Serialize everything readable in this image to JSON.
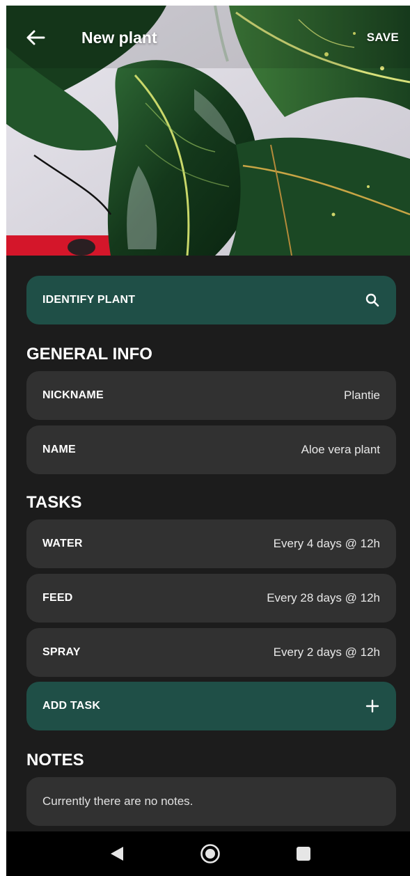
{
  "header": {
    "title": "New plant",
    "save_label": "SAVE"
  },
  "identify": {
    "label": "IDENTIFY PLANT",
    "icon": "search-icon"
  },
  "general_info": {
    "heading": "GENERAL INFO",
    "fields": [
      {
        "label": "NICKNAME",
        "value": "Plantie"
      },
      {
        "label": "NAME",
        "value": "Aloe vera plant"
      }
    ]
  },
  "tasks": {
    "heading": "TASKS",
    "items": [
      {
        "label": "WATER",
        "value": "Every 4 days @ 12h"
      },
      {
        "label": "FEED",
        "value": "Every 28 days @ 12h"
      },
      {
        "label": "SPRAY",
        "value": "Every 2 days @ 12h"
      }
    ],
    "add_label": "ADD TASK",
    "add_icon": "plus-icon"
  },
  "notes": {
    "heading": "NOTES",
    "empty_text": "Currently there are no notes."
  },
  "colors": {
    "background": "#1c1c1c",
    "card": "#313131",
    "accent": "#1f4f47",
    "text": "#ffffff"
  },
  "navbar": {
    "icons": [
      "nav-back-icon",
      "nav-home-icon",
      "nav-recent-icon"
    ]
  }
}
